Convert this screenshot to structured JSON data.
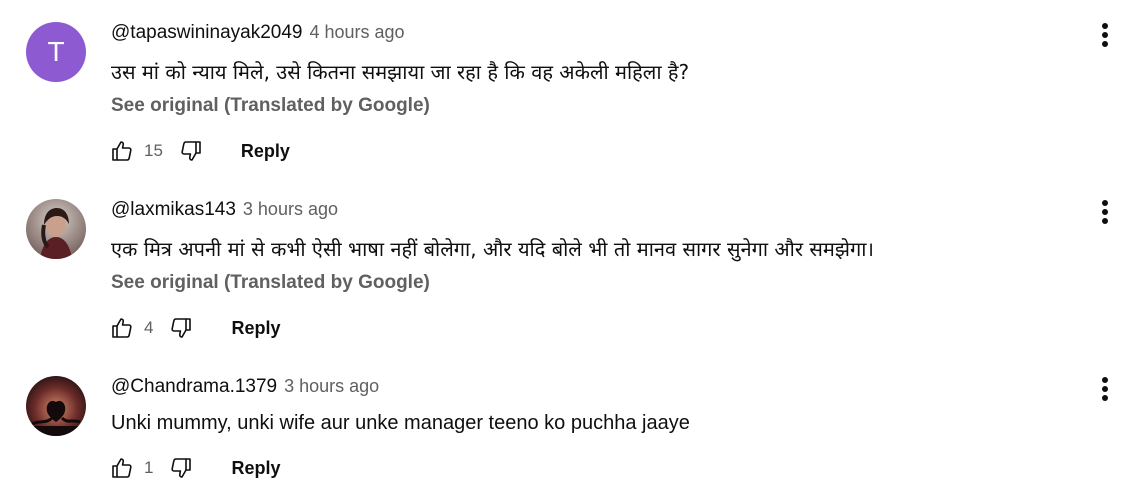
{
  "comments": [
    {
      "author": "@tapaswininayak2049",
      "time": "4 hours ago",
      "avatar_letter": "T",
      "text": "उस मां को न्याय मिले, उसे कितना समझाया जा रहा है कि वह अकेली महिला है?",
      "see_original": "See original (Translated by Google)",
      "likes": "15",
      "reply_label": "Reply"
    },
    {
      "author": "@laxmikas143",
      "time": "3 hours ago",
      "text": "एक मित्र अपनी मां से कभी ऐसी भाषा नहीं बोलेगा, और यदि बोले भी तो मानव सागर सुनेगा और समझेगा।",
      "see_original": "See original (Translated by Google)",
      "likes": "4",
      "reply_label": "Reply"
    },
    {
      "author": "@Chandrama.1379",
      "time": "3 hours ago",
      "text": "Unki mummy, unki wife aur unke manager teeno ko puchha jaaye",
      "likes": "1",
      "reply_label": "Reply"
    }
  ],
  "colors": {
    "avatar_t": "#8e5ad1",
    "secondary_text": "#606060",
    "primary_text": "#0f0f0f"
  },
  "icons": [
    "thumbs-up-icon",
    "thumbs-down-icon",
    "more-vert-icon"
  ]
}
